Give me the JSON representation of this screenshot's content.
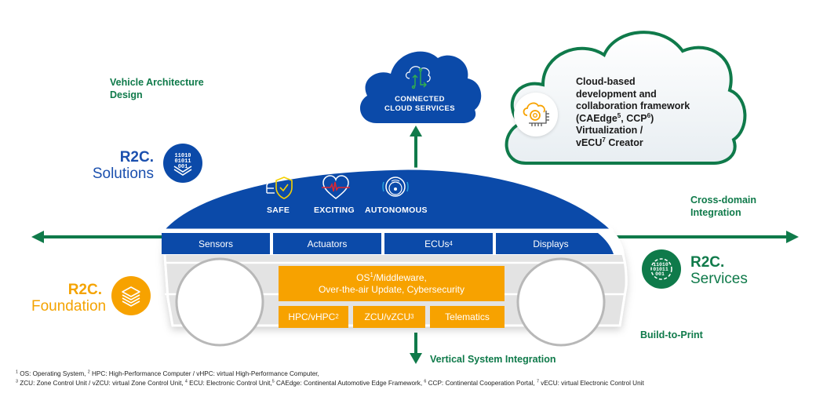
{
  "labels": {
    "vehicle_architecture": [
      "Vehicle Architecture",
      "Design"
    ],
    "cross_domain": [
      "Cross-domain",
      "Integration"
    ],
    "build_to_print": "Build-to-Print",
    "vertical_integration": "Vertical System Integration"
  },
  "r2c": {
    "solutions": {
      "title": "R2C.",
      "subtitle": "Solutions",
      "icon": "binary-layers-icon",
      "color": "#1a4fae"
    },
    "foundation": {
      "title": "R2C.",
      "subtitle": "Foundation",
      "icon": "stack-layers-icon",
      "color": "#f4a300"
    },
    "services": {
      "title": "R2C.",
      "subtitle": "Services",
      "icon": "binary-gear-icon",
      "color": "#0f7a4a"
    }
  },
  "connected_cloud": {
    "lines": [
      "CONNECTED",
      "CLOUD SERVICES"
    ],
    "icon": "cloud-circuit-icon"
  },
  "dev_cloud": {
    "icon": "cloud-gear-chip-icon",
    "lines": [
      {
        "text": "Cloud-based"
      },
      {
        "text": "development and"
      },
      {
        "text": "collaboration framework"
      },
      {
        "text": "(CAEdge",
        "sup": "5",
        "after": ", CCP",
        "sup2": "6",
        "tail": ")"
      },
      {
        "text": "Virtualization /"
      },
      {
        "text": "vECU",
        "sup": "7",
        "after": " Creator"
      }
    ]
  },
  "car": {
    "features": [
      {
        "label": "SAFE",
        "icon": "car-shield-check-icon"
      },
      {
        "label": "EXCITING",
        "icon": "heart-pulse-icon"
      },
      {
        "label": "AUTONOMOUS",
        "icon": "steering-wheel-wireless-icon"
      }
    ],
    "hardware": [
      {
        "label": "Sensors"
      },
      {
        "label": "Actuators"
      },
      {
        "label": "ECUs",
        "sup": "4"
      },
      {
        "label": "Displays"
      }
    ],
    "software": {
      "main_lines": [
        {
          "text": "OS",
          "sup": "1",
          "after": "/Middleware,"
        },
        {
          "text": "Over-the-air Update, Cybersecurity"
        }
      ],
      "boxes": [
        {
          "label": "HPC/vHPC",
          "sup": "2"
        },
        {
          "label": "ZCU/vZCU",
          "sup": "3"
        },
        {
          "label": "Telematics"
        }
      ]
    }
  },
  "footnotes": [
    [
      {
        "sup": "1",
        "text": " OS: Operating System, "
      },
      {
        "sup": "2",
        "text": " HPC: High-Performance Computer / vHPC: virtual High-Performance Computer,"
      }
    ],
    [
      {
        "sup": "3",
        "text": " ZCU: Zone Control Unit / vZCU: virtual Zone Control Unit, "
      },
      {
        "sup": "4",
        "text": " ECU: Electronic Control Unit,"
      },
      {
        "sup": "5",
        "text": " CAEdge: Continental Automotive Edge Framework, "
      },
      {
        "sup": "6",
        "text": " CCP: Continental Cooperation Portal, "
      },
      {
        "sup": "7",
        "text": " vECU: virtual Electronic Control Unit"
      }
    ]
  ],
  "colors": {
    "blue": "#0b4aa9",
    "orange": "#f7a200",
    "green": "#0f7a4a",
    "grey": "#e2e2e2"
  }
}
